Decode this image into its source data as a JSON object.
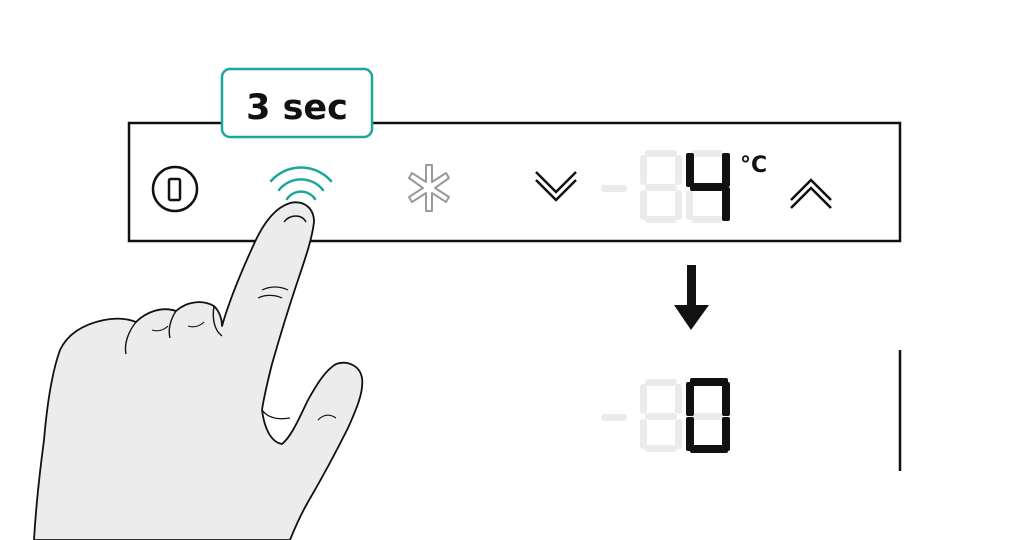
{
  "hold_label": "3 sec",
  "temperature_unit": "°C",
  "display_before": {
    "digits": "-84",
    "lit_digit": "4"
  },
  "display_after": {
    "digits": "-80",
    "lit_digit": "0"
  },
  "icons": {
    "power": "power-button-icon",
    "wifi": "wifi-icon",
    "snowflake": "snowflake-icon",
    "down": "chevron-down-icon",
    "up": "chevron-up-icon",
    "arrow": "arrow-down-icon",
    "hand": "pointing-hand-icon"
  },
  "colors": {
    "accent": "#1aa89a",
    "outline": "#111111",
    "dim_segment": "#ebebeb",
    "inactive_icon": "#9a9a9a",
    "skin": "#ececec"
  }
}
